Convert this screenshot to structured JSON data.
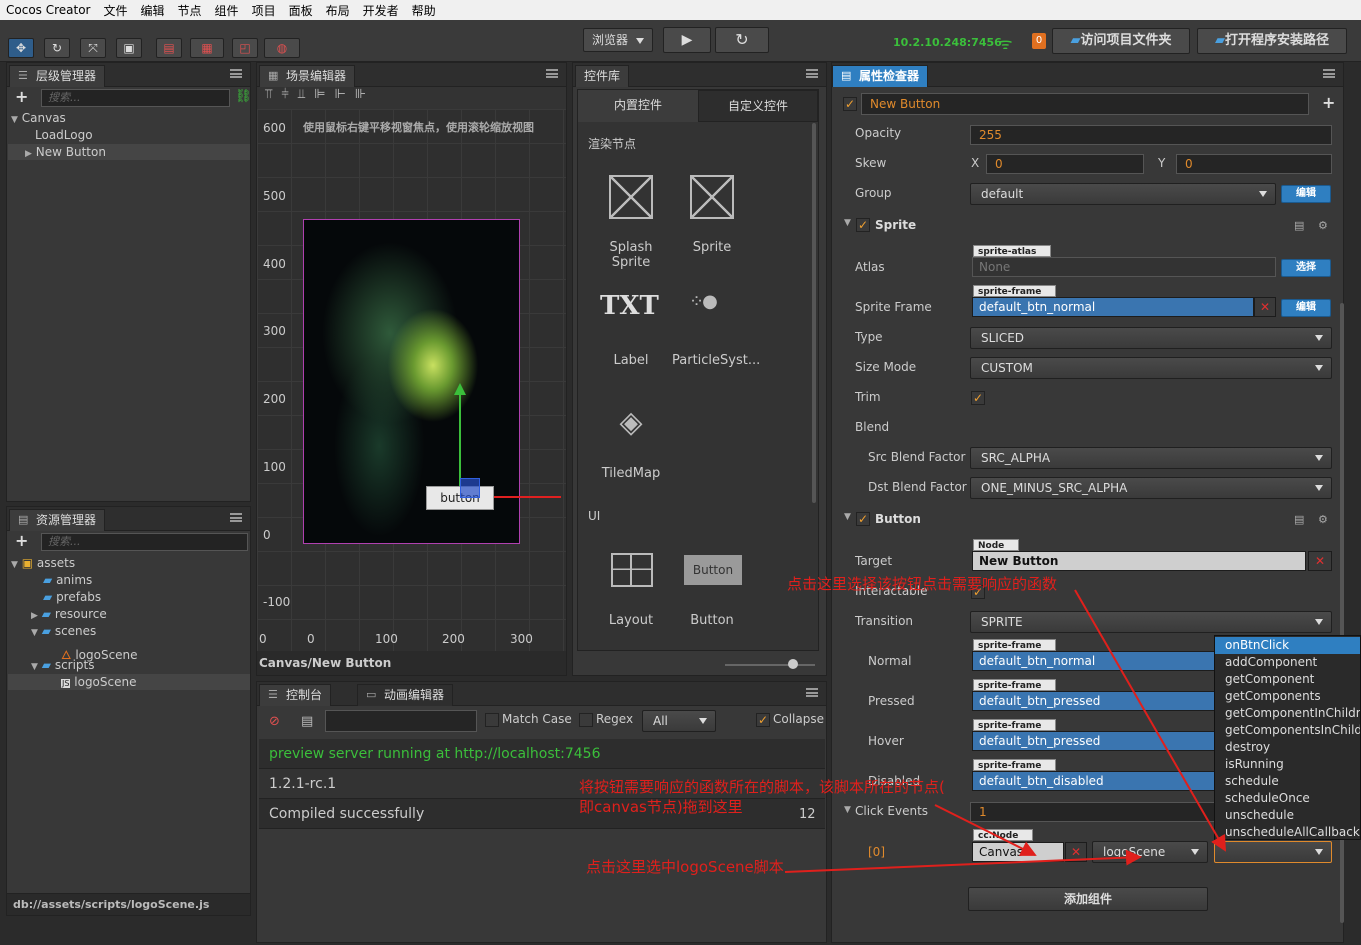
{
  "menubar": {
    "items": [
      "Cocos Creator",
      "文件",
      "编辑",
      "节点",
      "组件",
      "项目",
      "面板",
      "布局",
      "开发者",
      "帮助"
    ]
  },
  "toolbar": {
    "browser_label": "浏览器",
    "ip": "10.2.10.248:7456",
    "badge": "0",
    "open_project_folder": "访问项目文件夹",
    "open_install_path": "打开程序安装路径"
  },
  "hierarchy": {
    "title": "层级管理器",
    "search_placeholder": "搜索...",
    "nodes": [
      "Canvas",
      "LoadLogo",
      "New Button"
    ]
  },
  "assets": {
    "title": "资源管理器",
    "search_placeholder": "搜索...",
    "items": [
      "assets",
      "anims",
      "prefabs",
      "resource",
      "scenes",
      "logoScene",
      "scripts",
      "logoScene"
    ],
    "status_path": "db://assets/scripts/logoScene.js"
  },
  "scene": {
    "title": "场景编辑器",
    "hint": "使用鼠标右键平移视窗焦点，使用滚轮缩放视图",
    "y_ticks": [
      "600",
      "500",
      "400",
      "300",
      "200",
      "100",
      "0",
      "-100"
    ],
    "x_ticks": [
      "0",
      "0",
      "100",
      "200",
      "300"
    ],
    "button_text": "button",
    "breadcrumb": "Canvas/New Button"
  },
  "library": {
    "title": "控件库",
    "tab_builtin": "内置控件",
    "tab_custom": "自定义控件",
    "section_render": "渲染节点",
    "section_ui": "UI",
    "items": [
      "Splash Sprite",
      "Sprite",
      "Label",
      "ParticleSyst...",
      "TiledMap",
      "Layout",
      "Button"
    ],
    "txt_glyph": "TXT",
    "button_glyph": "Button"
  },
  "console": {
    "tab_console": "控制台",
    "tab_anim": "动画编辑器",
    "match_case": "Match Case",
    "regex": "Regex",
    "filter": "All",
    "collapse": "Collapse",
    "lines": [
      "preview server running at http://localhost:7456",
      "1.2.1-rc.1",
      "Compiled successfully"
    ],
    "count": "12"
  },
  "inspector": {
    "title": "属性检查器",
    "node_name": "New Button",
    "opacity_label": "Opacity",
    "opacity": "255",
    "skew_label": "Skew",
    "skew_x_label": "X",
    "skew_x": "0",
    "skew_y_label": "Y",
    "skew_y": "0",
    "group_label": "Group",
    "group": "default",
    "edit": "编辑",
    "sprite_section": "Sprite",
    "atlas_label": "Atlas",
    "atlas_tag": "sprite-atlas",
    "atlas": "None",
    "choose": "选择",
    "frame_label": "Sprite Frame",
    "frame_tag": "sprite-frame",
    "frame": "default_btn_normal",
    "type_label": "Type",
    "type": "SLICED",
    "sizemode_label": "Size Mode",
    "sizemode": "CUSTOM",
    "trim_label": "Trim",
    "blend_label": "Blend",
    "src_label": "Src Blend Factor",
    "src": "SRC_ALPHA",
    "dst_label": "Dst Blend Factor",
    "dst": "ONE_MINUS_SRC_ALPHA",
    "button_section": "Button",
    "target_label": "Target",
    "target_tag": "Node",
    "target": "New Button",
    "interactable_label": "Interactable",
    "transition_label": "Transition",
    "transition": "SPRITE",
    "normal_label": "Normal",
    "normal": "default_btn_normal",
    "pressed_label": "Pressed",
    "pressed": "default_btn_pressed",
    "hover_label": "Hover",
    "hover": "default_btn_pressed",
    "disabled_label": "Disabled",
    "disabled": "default_btn_disabled",
    "clickevents_label": "Click Events",
    "clickevents": "1",
    "event_index": "[0]",
    "event_node_tag": "cc.Node",
    "event_node": "Canvas",
    "event_component": "logoScene",
    "add_component": "添加组件"
  },
  "dropdown": {
    "items": [
      "onBtnClick",
      "addComponent",
      "getComponent",
      "getComponents",
      "getComponentInChildren",
      "getComponentsInChildren",
      "destroy",
      "isRunning",
      "schedule",
      "scheduleOnce",
      "unschedule",
      "unscheduleAllCallbacks"
    ]
  },
  "annotations": {
    "note1": "点击这里选择该按钮点击需要响应的函数",
    "note2a": "将按钮需要响应的函数所在的脚本，该脚本所在的节点(",
    "note2b": "即canvas节点)拖到这里",
    "note3": "点击这里选中logoScene脚本"
  }
}
